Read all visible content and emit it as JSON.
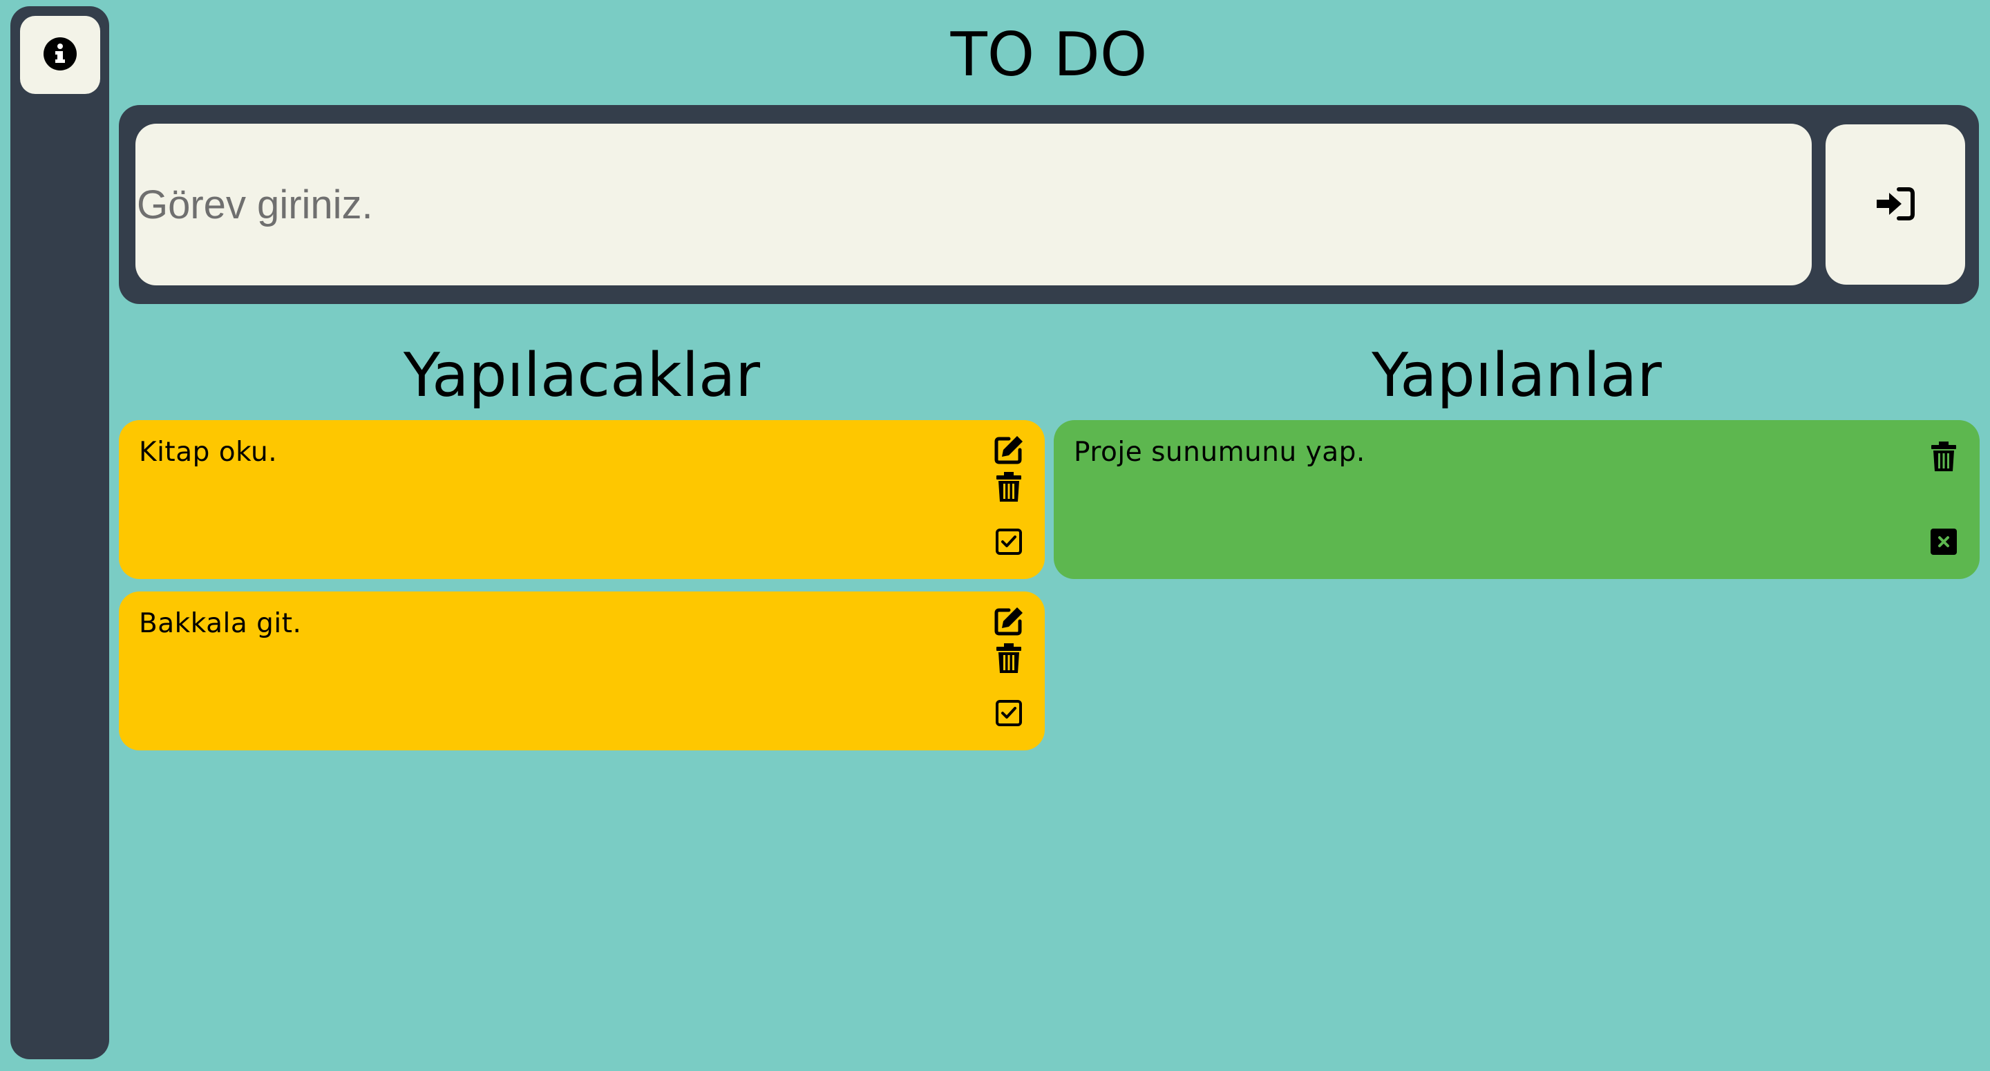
{
  "sidebar": {
    "info_icon": "info-circle-icon"
  },
  "header": {
    "title": "TO DO"
  },
  "input": {
    "placeholder": "Görev giriniz.",
    "value": "",
    "submit_icon": "sign-in-arrow-icon"
  },
  "columns": {
    "todo_title": "Yapılacaklar",
    "done_title": "Yapılanlar"
  },
  "todo_items": [
    {
      "text": "Kitap oku."
    },
    {
      "text": "Bakkala git."
    }
  ],
  "done_items": [
    {
      "text": "Proje sunumunu yap."
    }
  ],
  "colors": {
    "background": "#7accc4",
    "panel": "#343e4b",
    "input_bg": "#f3f3e8",
    "todo_card": "#fec700",
    "done_card": "#5db74f"
  }
}
